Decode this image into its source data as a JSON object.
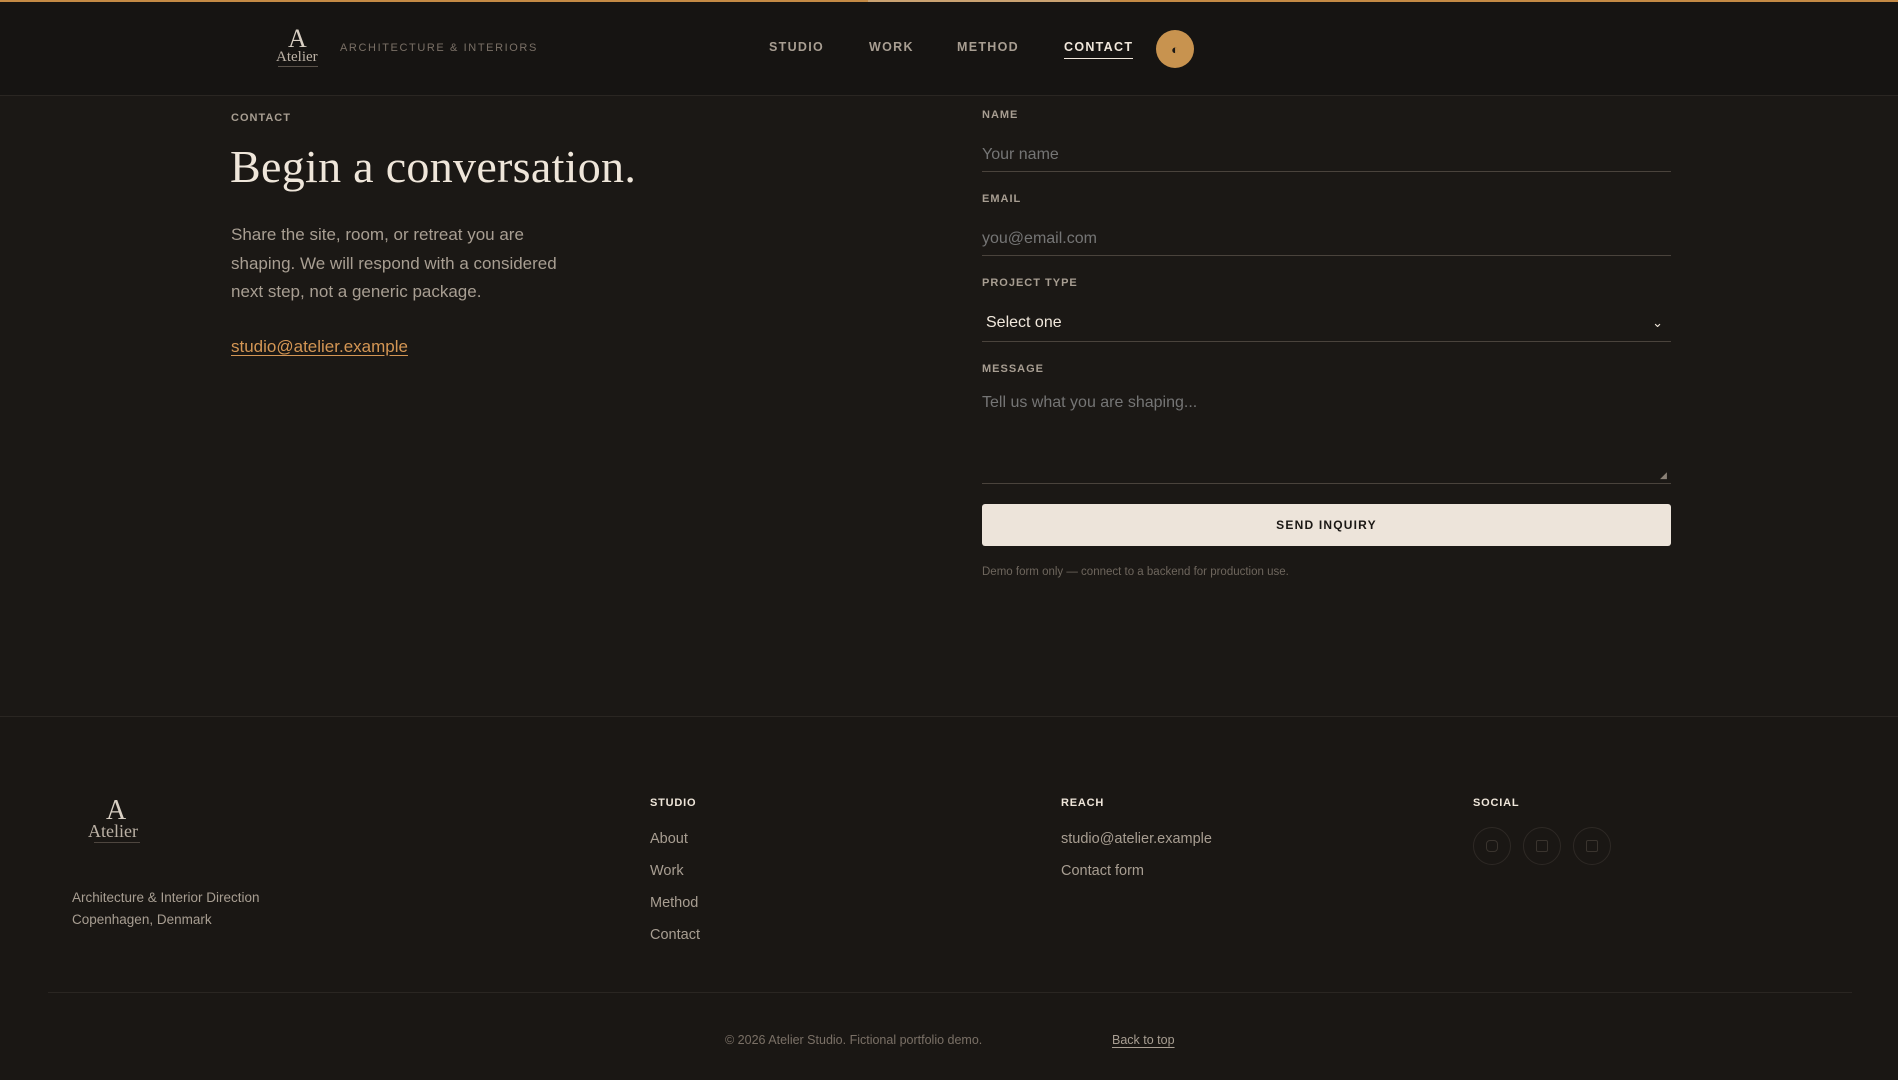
{
  "header": {
    "logo_mark": "A",
    "logo_word": "Atelier",
    "tagline": "ARCHITECTURE & INTERIORS",
    "nav": [
      {
        "label": "STUDIO"
      },
      {
        "label": "WORK"
      },
      {
        "label": "METHOD"
      },
      {
        "label": "CONTACT",
        "active": true
      }
    ],
    "theme_toggle_icon": "◐"
  },
  "contact": {
    "eyebrow": "CONTACT",
    "heading": "Begin a conversation.",
    "intro": "Share the site, room, or retreat you are shaping. We will respond with a considered next step, not a generic package.",
    "email": "studio@atelier.example"
  },
  "form": {
    "name_label": "NAME",
    "name_placeholder": "Your name",
    "email_label": "EMAIL",
    "email_placeholder": "you@email.com",
    "project_label": "PROJECT TYPE",
    "project_value": "Select one",
    "message_label": "MESSAGE",
    "message_placeholder": "Tell us what you are shaping...",
    "submit": "SEND INQUIRY",
    "note": "Demo form only — connect to a backend for production use."
  },
  "footer": {
    "logo_mark": "A",
    "logo_word": "Atelier",
    "desc_line1": "Architecture & Interior Direction",
    "desc_line2": "Copenhagen, Denmark",
    "studio_head": "STUDIO",
    "studio_links": [
      "About",
      "Work",
      "Method",
      "Contact"
    ],
    "reach_head": "REACH",
    "reach_links": [
      "studio@atelier.example",
      "Contact form"
    ],
    "social_head": "SOCIAL",
    "social_icons": [
      "instagram-icon",
      "pinterest-icon",
      "linkedin-icon"
    ],
    "copyright": "© 2026 Atelier Studio. Fictional portfolio demo.",
    "back_to_top": "Back to top"
  },
  "colors": {
    "background": "#1b1815",
    "accent": "#c8934f",
    "link": "#d49654",
    "button": "#ede4da"
  }
}
